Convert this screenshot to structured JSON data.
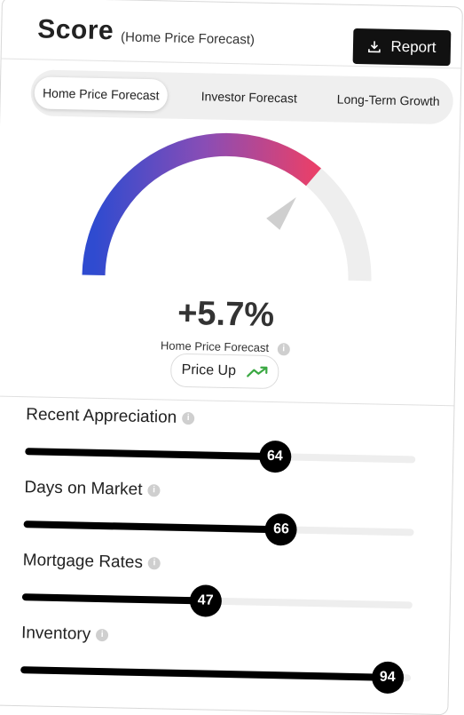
{
  "header": {
    "title": "Score",
    "subtitle": "(Home Price Forecast)",
    "report_label": "Report"
  },
  "tabs": [
    {
      "label": "Home Price Forecast",
      "active": true
    },
    {
      "label": "Investor Forecast",
      "active": false
    },
    {
      "label": "Long-Term Growth",
      "active": false
    }
  ],
  "gauge": {
    "value": "+5.7%",
    "label": "Home Price Forecast",
    "level": 0.72,
    "gradient_colors": [
      "#2f4bd0",
      "#8a4db5",
      "#e8406a"
    ],
    "track_color": "#eeeeee"
  },
  "status_pill": {
    "label": "Price Up",
    "icon": "trending-up-icon",
    "icon_color": "#3aa842"
  },
  "metrics": [
    {
      "label": "Recent Appreciation",
      "value": 64
    },
    {
      "label": "Days on Market",
      "value": 66
    },
    {
      "label": "Mortgage Rates",
      "value": 47
    },
    {
      "label": "Inventory",
      "value": 94
    }
  ],
  "info_icon_text": "i"
}
